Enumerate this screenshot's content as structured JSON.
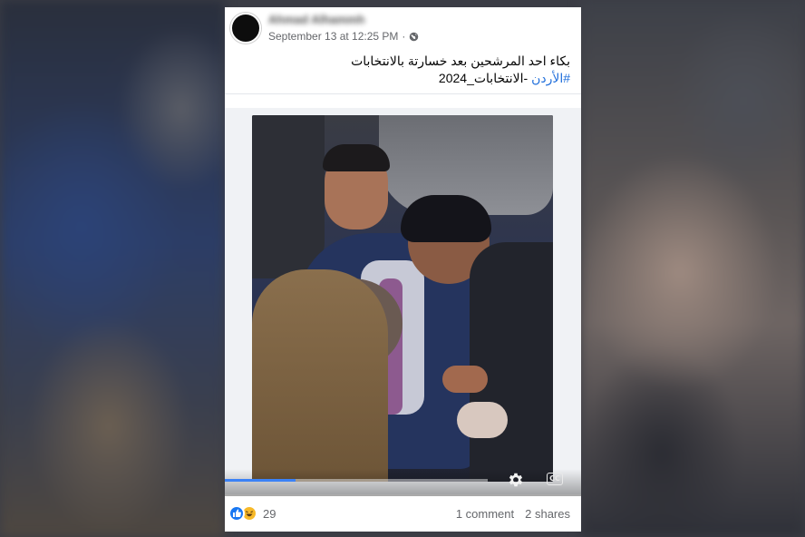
{
  "post": {
    "author": "Ahmad Alhammh",
    "timestamp": "September 13 at 12:25 PM",
    "separator": "·",
    "privacy_icon": "globe-icon",
    "caption_line1": "بكاء احد المرشحين بعد خسارتة بالانتخابات",
    "hashtag": "#الأردن",
    "caption_line2_rest": " -الانتخابات_2024"
  },
  "video": {
    "progress": 0.27,
    "settings_icon": "gear-icon",
    "captions_label": "CC"
  },
  "footer": {
    "reaction_icons": [
      "like-icon",
      "haha-icon"
    ],
    "reaction_count": "29",
    "comments_label": "1 comment",
    "shares_label": "2 shares"
  },
  "colors": {
    "hashtag": "#216fdb",
    "progress": "#3b82f6",
    "like": "#1877f2",
    "haha": "#f7b928"
  }
}
